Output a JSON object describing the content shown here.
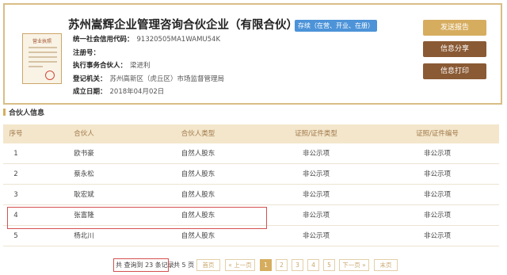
{
  "company": {
    "name": "苏州嵩辉企业管理咨询合伙企业（有限合伙）",
    "status": "存续（在营、开业、在册）",
    "license_text": "营业执照",
    "fields": [
      {
        "label": "统一社会信用代码：",
        "value": "91320505MA1WAMU54K"
      },
      {
        "label": "注册号：",
        "value": ""
      },
      {
        "label": "执行事务合伙人：",
        "value": "梁进利"
      },
      {
        "label": "登记机关：",
        "value": "苏州高新区（虎丘区）市场监督管理局"
      },
      {
        "label": "成立日期：",
        "value": "2018年04月02日"
      }
    ],
    "buttons": {
      "report": "发送报告",
      "share": "信息分享",
      "print": "信息打印"
    }
  },
  "section": {
    "title": "合伙人信息"
  },
  "table": {
    "headers": [
      "序号",
      "合伙人",
      "合伙人类型",
      "证照/证件类型",
      "证照/证件编号"
    ],
    "rows": [
      [
        "1",
        "欧书豪",
        "自然人股东",
        "非公示项",
        "非公示项"
      ],
      [
        "2",
        "蔡永松",
        "自然人股东",
        "非公示项",
        "非公示项"
      ],
      [
        "3",
        "耿宏斌",
        "自然人股东",
        "非公示项",
        "非公示项"
      ],
      [
        "4",
        "张富隆",
        "自然人股东",
        "非公示项",
        "非公示项"
      ],
      [
        "5",
        "杨北川",
        "自然人股东",
        "非公示项",
        "非公示项"
      ]
    ],
    "highlighted_row": "4"
  },
  "pagination": {
    "total_text": "共 查询到 23 条记录",
    "pages_text": "共 5 页",
    "first": "首页",
    "prev": "« 上一页",
    "pages": [
      "1",
      "2",
      "3",
      "4",
      "5"
    ],
    "current": "1",
    "next": "下一页 »",
    "last": "末页"
  },
  "colors": {
    "accent": "#d6ad5f",
    "brown": "#8a5a34",
    "status_blue": "#4c93d8",
    "highlight_red": "#d55050"
  }
}
